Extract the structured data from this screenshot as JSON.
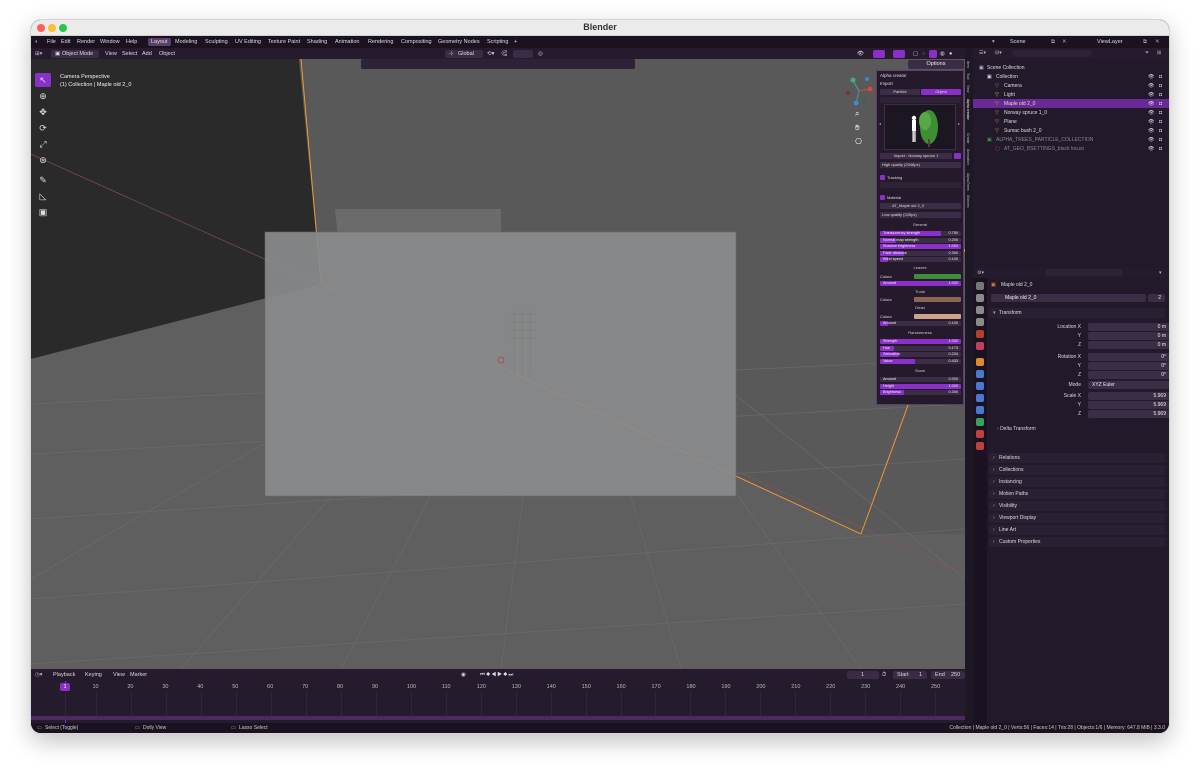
{
  "window": {
    "title": "Blender"
  },
  "menu": [
    "File",
    "Edit",
    "Render",
    "Window",
    "Help"
  ],
  "workspaces": [
    "Layout",
    "Modeling",
    "Sculpting",
    "UV Editing",
    "Texture Paint",
    "Shading",
    "Animation",
    "Rendering",
    "Compositing",
    "Geometry Nodes",
    "Scripting"
  ],
  "scene": {
    "name": "Scene",
    "view_layer": "ViewLayer"
  },
  "header3d": {
    "mode": "Object Mode",
    "menu": [
      "View",
      "Select",
      "Add",
      "Object"
    ],
    "orientation": "Global",
    "options": "Options"
  },
  "viewport": {
    "perspective": "Camera Perspective",
    "collection_info": "(1) Collection | Maple old 2_0"
  },
  "npanel": {
    "title": "Alpha creator",
    "import_label": "Import",
    "mode_particle": "Particle",
    "mode_object": "Object",
    "import_name": "Import : Norway spruce 1",
    "quality_high": "High quality (2048px)",
    "tracking": "Tracking",
    "material": "Material",
    "material_name": "AT_Maple old 2_0",
    "quality_low": "Low quality (245px)",
    "general": "General",
    "general_rows": [
      {
        "label": "Translucency strength",
        "value": "0.750",
        "fill": 0.75
      },
      {
        "label": "Normal map strength",
        "value": "0.200",
        "fill": 0.2
      },
      {
        "label": "Shadow brightness",
        "value": "1.000",
        "fill": 1.0
      },
      {
        "label": "Fade distance",
        "value": "0.300",
        "fill": 0.3
      },
      {
        "label": "Wind speed",
        "value": "0.100",
        "fill": 0.1
      }
    ],
    "leaves": "Leaves",
    "colour": "Colour",
    "amount": "Amount",
    "leaves_amount": "1.000",
    "trunk": "Trunk",
    "dead": "Dead",
    "dead_amount": "0.100",
    "randomness": "Randomness",
    "rand_rows": [
      {
        "label": "Strength",
        "value": "1.000",
        "fill": 1.0
      },
      {
        "label": "Hue",
        "value": "0.173",
        "fill": 0.17
      },
      {
        "label": "Saturation",
        "value": "0.234",
        "fill": 0.23
      },
      {
        "label": "Value",
        "value": "0.433",
        "fill": 0.43
      }
    ],
    "snow": "Snow",
    "snow_rows": [
      {
        "label": "Amount",
        "value": "0.000",
        "fill": 0.0
      },
      {
        "label": "Height",
        "value": "1.000",
        "fill": 1.0
      },
      {
        "label": "Brightness",
        "value": "0.300",
        "fill": 0.3
      }
    ],
    "colors": {
      "leaves": "#3a8f38",
      "trunk": "#8a6654",
      "dead": "#c9a58a"
    }
  },
  "ntabs": [
    "Item",
    "Tool",
    "View",
    "Alpha creator",
    "Create",
    "Animation",
    "AlphaTrees",
    "Shelves"
  ],
  "outliner": {
    "root": "Scene Collection",
    "items": [
      {
        "name": "Collection",
        "depth": 0
      },
      {
        "name": "Camera",
        "depth": 1
      },
      {
        "name": "Light",
        "depth": 1
      },
      {
        "name": "Maple old 2_0",
        "depth": 1
      },
      {
        "name": "Norway spruce 1_0",
        "depth": 1
      },
      {
        "name": "Plane",
        "depth": 1
      },
      {
        "name": "Sumac bush 2_0",
        "depth": 1
      },
      {
        "name": "ALPHA_TREES_PARTICLE_COLLECTION",
        "depth": 0
      },
      {
        "name": "AT_GEO_BSETTINGS_black locust",
        "depth": 1
      }
    ]
  },
  "properties": {
    "object_name": "Maple old 2_0",
    "datablock": "Maple old 2_0",
    "users": "2",
    "transform": "Transform",
    "location_x": "Location X",
    "location": [
      "0 m",
      "0 m",
      "0 m"
    ],
    "rotation_x": "Rotation X",
    "rotation": [
      "0°",
      "0°",
      "0°"
    ],
    "mode_label": "Mode",
    "mode": "XYZ Euler",
    "scale_x": "Scale X",
    "scale": [
      "5.969",
      "5.969",
      "5.969"
    ],
    "y": "Y",
    "z": "Z",
    "delta": "Delta Transform",
    "sections": [
      "Relations",
      "Collections",
      "Instancing",
      "Motion Paths",
      "Visibility",
      "Viewport Display",
      "Line Art",
      "Custom Properties"
    ]
  },
  "timeline": {
    "menu": [
      "Playback",
      "Keying",
      "View",
      "Marker"
    ],
    "current": "1",
    "start_label": "Start",
    "start": "1",
    "end_label": "End",
    "end": "250",
    "ticks": [
      "1",
      "10",
      "20",
      "30",
      "40",
      "50",
      "60",
      "70",
      "80",
      "90",
      "100",
      "110",
      "120",
      "130",
      "140",
      "150",
      "160",
      "170",
      "180",
      "190",
      "200",
      "210",
      "220",
      "230",
      "240",
      "250"
    ]
  },
  "status": {
    "left": "Select (Toggle)",
    "mid": "Dolly View",
    "right_action": "Lasso Select",
    "stats": "Collection | Maple old 2_0 | Verts:56 | Faces:14 | Tris:28 | Objects:1/6 | Memory: 647.8 MiB | 3.3.0"
  }
}
